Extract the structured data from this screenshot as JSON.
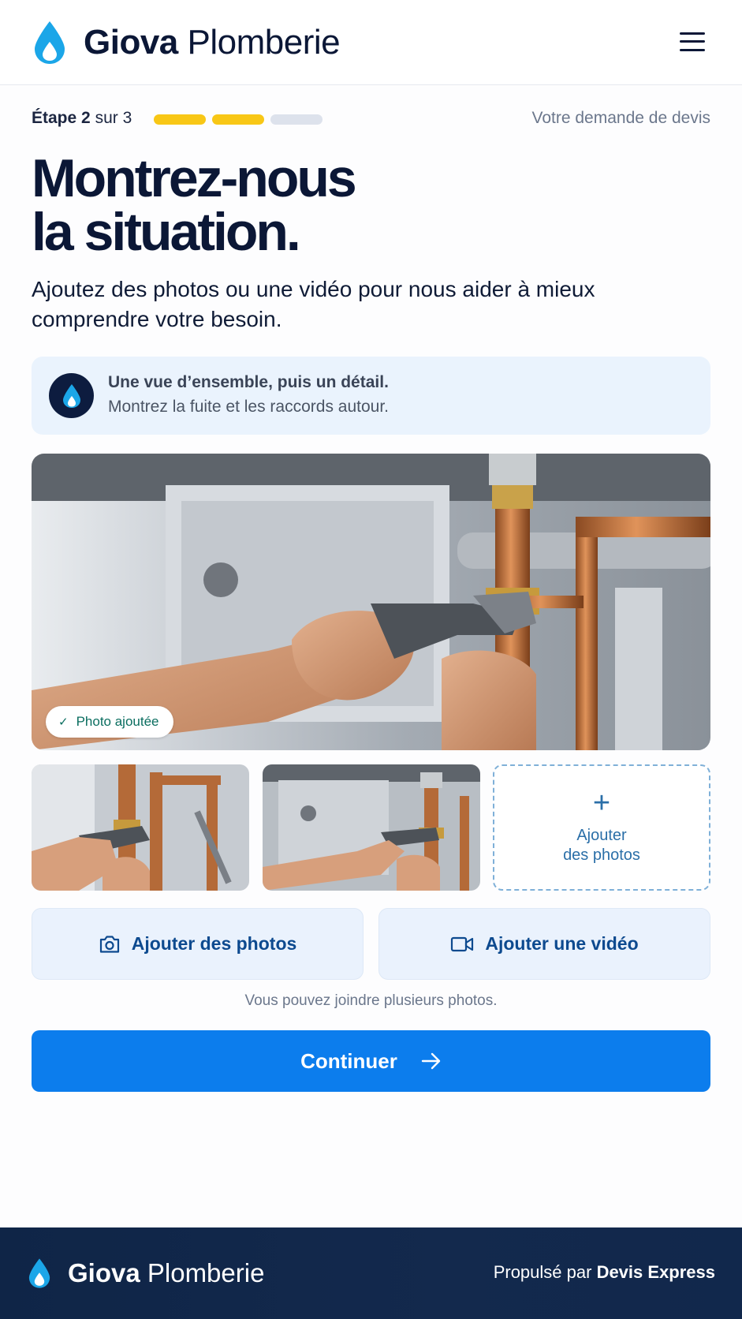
{
  "header": {
    "brand_bold": "Giova",
    "brand_regular": "Plomberie",
    "logo_icon": "water-drop-icon",
    "menu_icon": "hamburger-menu-icon"
  },
  "step": {
    "prefix": "Étape",
    "current": "2",
    "sep": "sur",
    "total": "3",
    "progress_segments": [
      {
        "state": "done",
        "color": "#f8c716"
      },
      {
        "state": "done",
        "color": "#f8c716"
      },
      {
        "state": "todo",
        "color": "#dde2ec"
      }
    ],
    "right_label": "Votre demande de devis"
  },
  "title": {
    "line1": "Montrez-nous",
    "line2": "la situation."
  },
  "subtitle": "Ajoutez des photos ou une vidéo pour nous aider à mieux comprendre votre besoin.",
  "tip": {
    "icon": "water-drop-icon",
    "title": "Une vue d’ensemble, puis un détail.",
    "text": "Montrez la fuite et les raccords autour."
  },
  "main_photo": {
    "badge": "Photo ajoutée",
    "badge_icon": "check-icon"
  },
  "add_tile": {
    "icon": "plus-icon",
    "line1": "Ajouter",
    "line2": "des photos"
  },
  "actions": {
    "photos_label": "Ajouter des photos",
    "photos_icon": "camera-icon",
    "video_label": "Ajouter une vidéo",
    "video_icon": "video-camera-icon",
    "hint": "Vous pouvez joindre plusieurs photos."
  },
  "continue": {
    "label": "Continuer",
    "icon": "arrow-right-icon"
  },
  "footer": {
    "brand_bold": "Giova",
    "brand_regular": "Plomberie",
    "powered_prefix": "Propulsé par",
    "powered_brand": "Devis Express"
  },
  "colors": {
    "primary": "#0c7ded",
    "navy": "#0b1736",
    "accent_yellow": "#f8c716",
    "tip_bg": "#eaf3fd",
    "footer_bg": "#13294d"
  }
}
